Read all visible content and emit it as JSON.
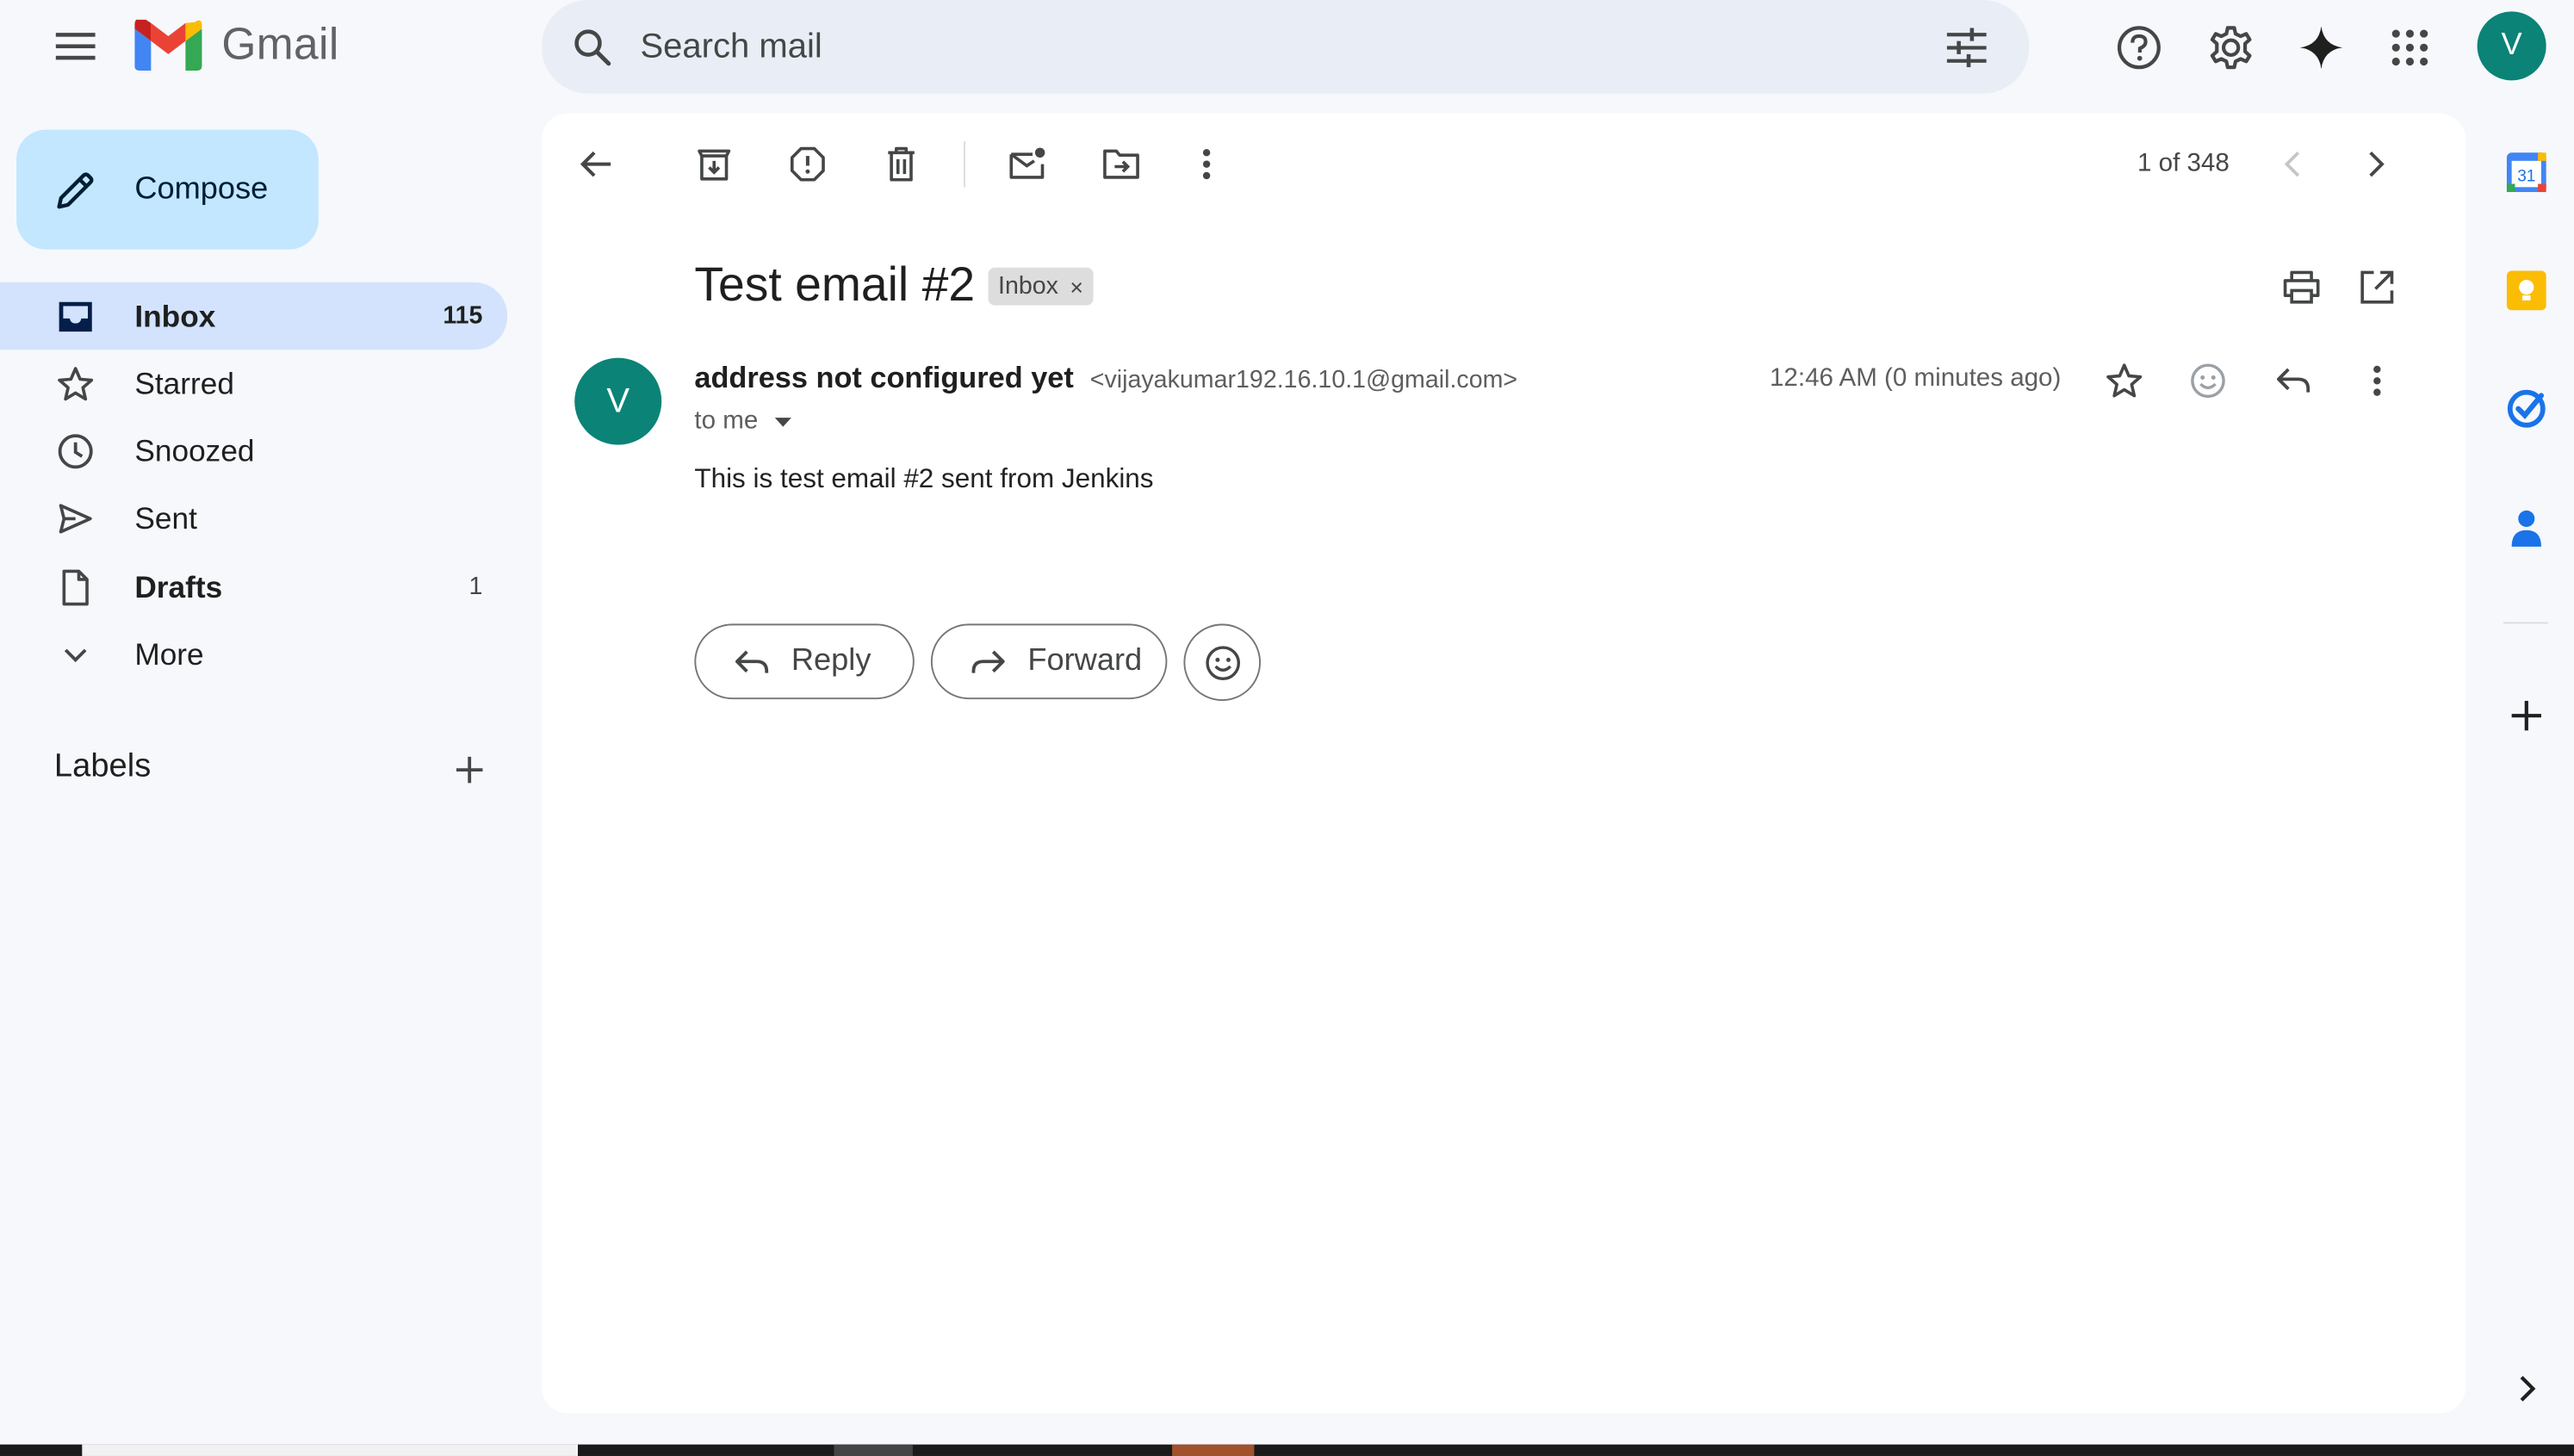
{
  "app": {
    "name": "Gmail"
  },
  "search": {
    "placeholder": "Search mail"
  },
  "account": {
    "initial": "V"
  },
  "compose": {
    "label": "Compose"
  },
  "nav": {
    "items": [
      {
        "label": "Inbox",
        "count": "115"
      },
      {
        "label": "Starred",
        "count": ""
      },
      {
        "label": "Snoozed",
        "count": ""
      },
      {
        "label": "Sent",
        "count": ""
      },
      {
        "label": "Drafts",
        "count": "1"
      },
      {
        "label": "More",
        "count": ""
      }
    ],
    "labels_heading": "Labels"
  },
  "toolbar": {
    "pager": "1 of 348"
  },
  "message": {
    "subject": "Test email #2",
    "label_chip": "Inbox",
    "chip_close": "×",
    "sender_initial": "V",
    "sender_name": "address not configured yet",
    "sender_email": "<vijayakumar192.16.10.1@gmail.com>",
    "to": "to me",
    "time": "12:46 AM (0 minutes ago)",
    "body": "This is test email #2 sent from Jenkins"
  },
  "actions": {
    "reply_label": "Reply",
    "forward_label": "Forward"
  },
  "side_panel": {
    "calendar_day": "31"
  },
  "colors": {
    "accent": "#0b57d0",
    "avatar": "#0b8377",
    "compose_bg": "#c2e7ff",
    "active_nav": "#d3e3fd"
  }
}
